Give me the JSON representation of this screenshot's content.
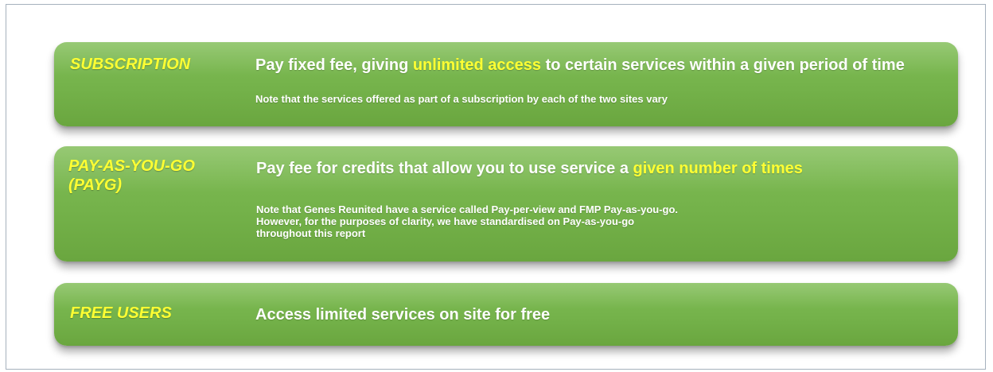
{
  "rows": [
    {
      "label": "SUBSCRIPTION",
      "main_before": "Pay fixed fee, giving ",
      "main_highlight": "unlimited access",
      "main_after": " to certain services within a given period of time",
      "note_lines": [
        "Note that the services offered as part of a subscription by each of the two sites vary"
      ]
    },
    {
      "label_lines": [
        "PAY-AS-YOU-GO",
        "(PAYG)"
      ],
      "main_before": "Pay fee for credits that allow you to use service a ",
      "main_highlight": "given number of times",
      "main_after": "",
      "note_lines": [
        "Note that Genes Reunited have a service called Pay-per-view and FMP Pay-as-you-go.",
        "However, for the purposes of clarity, we have standardised on Pay-as-you-go",
        "throughout this report"
      ]
    },
    {
      "label": "FREE USERS",
      "main": "Access limited services on site for free"
    }
  ],
  "colors": {
    "panel_green": "#74b24a",
    "label_yellow": "#ffff33",
    "highlight_yellow": "#ffff33",
    "text_white": "#ffffff",
    "frame_border": "#a6b1bd"
  }
}
